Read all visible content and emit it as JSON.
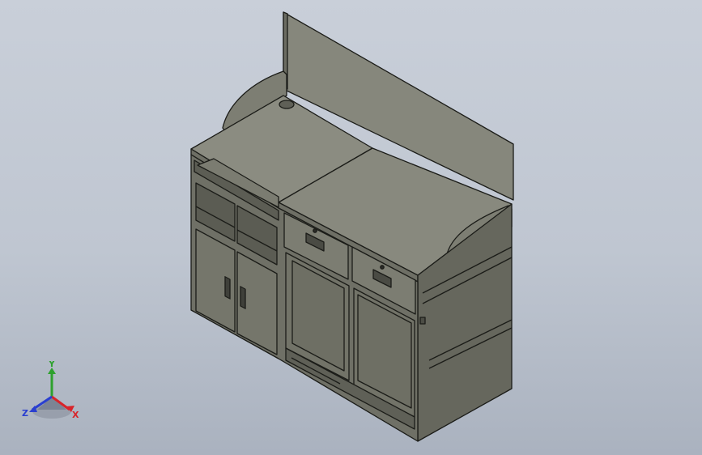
{
  "triad": {
    "x_label": "X",
    "y_label": "Y",
    "z_label": "Z"
  },
  "colors": {
    "background_top": "#c9cfd9",
    "background_bottom": "#aab2bf",
    "model_light": "#87887d",
    "model_mid": "#75766b",
    "model_dark": "#64655b",
    "edge": "#1b1c18",
    "axis_x": "#d8242a",
    "axis_y": "#2ea12e",
    "axis_z": "#2a3fd0"
  }
}
